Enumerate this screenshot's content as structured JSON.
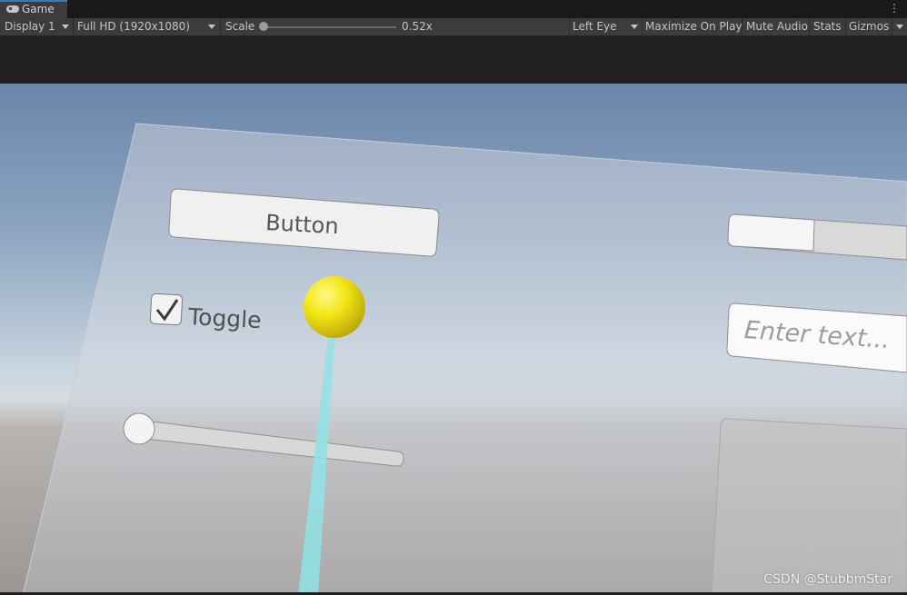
{
  "tab": {
    "title": "Game",
    "icon": "gamepad-icon",
    "menu_icon": "kebab-menu-icon"
  },
  "toolbar": {
    "display": "Display 1",
    "resolution": "Full HD (1920x1080)",
    "scale_label": "Scale",
    "scale_value": "0.52x",
    "scale_fraction": 0.0,
    "eye": "Left Eye",
    "maximize": "Maximize On Play",
    "mute": "Mute Audio",
    "stats": "Stats",
    "gizmos": "Gizmos"
  },
  "scene": {
    "button_label": "Button",
    "toggle_label": "Toggle",
    "toggle_checked": true,
    "input_placeholder": "Enter text...",
    "slider_value": 0.0,
    "scrollbar_value": 0.3,
    "colors": {
      "sphere": "#f5e81a",
      "ray": "#8fe3e6",
      "panel": "#c8cdd6"
    }
  },
  "watermark": "CSDN @StubbmStar"
}
